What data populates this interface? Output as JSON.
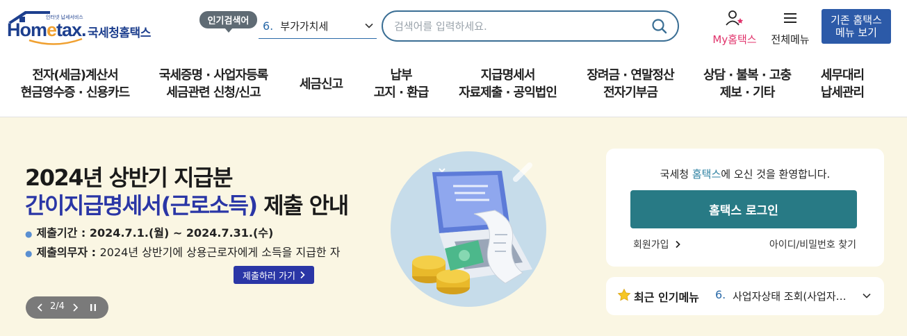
{
  "header": {
    "logo": {
      "brand": "Hometax",
      "tagline": "인터넷 납세서비스",
      "name": "국세청홈택스"
    },
    "popular_search": {
      "badge": "인기검색어",
      "rank": "6.",
      "term": "부가가치세"
    },
    "search": {
      "placeholder": "검색어를 입력하세요.",
      "value": ""
    },
    "my_hometax": "My홈택스",
    "all_menu": "전체메뉴",
    "legacy_button": {
      "line1": "기존 홈택스",
      "line2": "메뉴 보기"
    }
  },
  "gnb": [
    {
      "line1": "전자(세금)계산서",
      "line2": "현금영수증 · 신용카드"
    },
    {
      "line1": "국세증명 · 사업자등록",
      "line2": "세금관련 신청/신고"
    },
    {
      "line1": "세금신고",
      "line2": ""
    },
    {
      "line1": "납부",
      "line2": "고지 · 환급"
    },
    {
      "line1": "지급명세서",
      "line2": "자료제출 · 공익법인"
    },
    {
      "line1": "장려금 · 연말정산",
      "line2": "전자기부금"
    },
    {
      "line1": "상담 · 불복 · 고충",
      "line2": "제보 · 기타"
    },
    {
      "line1": "세무대리",
      "line2": "납세관리"
    }
  ],
  "banner": {
    "title_line1": "2024년 상반기 지급분",
    "title_accent": "간이지급명세서(근로소득)",
    "title_rest": " 제출 안내",
    "period_label": "제출기간 : ",
    "period_value": "2024.7.1.(월) ~ 2024.7.31.(수)",
    "obligor_label": "제출의무자 : ",
    "obligor_value": "2024년 상반기에 상용근로자에게 소득을 지급한 자",
    "cta": "제출하러 가기",
    "slide_counter": "2/4"
  },
  "login": {
    "welcome_pre": "국세청 ",
    "welcome_brand": "홈택스",
    "welcome_post": "에 오신 것을 환영합니다.",
    "button": "홈택스 로그인",
    "join": "회원가입",
    "find": "아이디/비밀번호 찾기"
  },
  "popular_menu": {
    "title": "최근 인기메뉴",
    "rank": "6.",
    "item": "사업자상태 조회(사업자등록번호)"
  },
  "colors": {
    "brand_navy": "#1d3f8e",
    "search_border": "#3a6e94",
    "my_pink": "#e0336b",
    "legacy_blue": "#2c5aa8",
    "banner_bg": "#faf6e3",
    "banner_accent": "#2a36a6",
    "login_teal": "#287a85"
  },
  "icons": [
    "home-roof-icon",
    "chevron-down-icon",
    "search-icon",
    "user-icon",
    "hamburger-icon",
    "chevron-left-icon",
    "chevron-right-icon",
    "pause-icon",
    "star-icon"
  ]
}
